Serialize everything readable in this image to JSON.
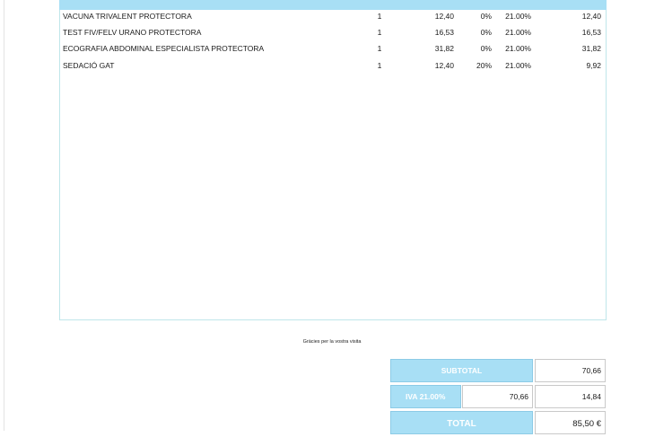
{
  "items": [
    {
      "description": "VACUNA TRIVALENT PROTECTORA",
      "qty": "1",
      "price": "12,40",
      "discount": "0%",
      "vat": "21.00%",
      "total": "12,40"
    },
    {
      "description": "TEST FIV/FELV URANO PROTECTORA",
      "qty": "1",
      "price": "16,53",
      "discount": "0%",
      "vat": "21.00%",
      "total": "16,53"
    },
    {
      "description": "ECOGRAFIA ABDOMINAL ESPECIALISTA PROTECTORA",
      "qty": "1",
      "price": "31,82",
      "discount": "0%",
      "vat": "21.00%",
      "total": "31,82"
    },
    {
      "description": "SEDACIÓ GAT",
      "qty": "1",
      "price": "12,40",
      "discount": "20%",
      "vat": "21.00%",
      "total": "9,92"
    }
  ],
  "footer": {
    "thanks": "Gràcies per la vostra visita"
  },
  "totals": {
    "subtotal_label": "SUBTOTAL",
    "subtotal_value": "70,66",
    "vat_label": "IVA 21.00%",
    "vat_base": "70,66",
    "vat_amount": "14,84",
    "total_label": "TOTAL",
    "total_value": "85,50 €"
  },
  "colors": {
    "header_blue": "#a8dff5",
    "box_border": "#bfe6ea"
  }
}
